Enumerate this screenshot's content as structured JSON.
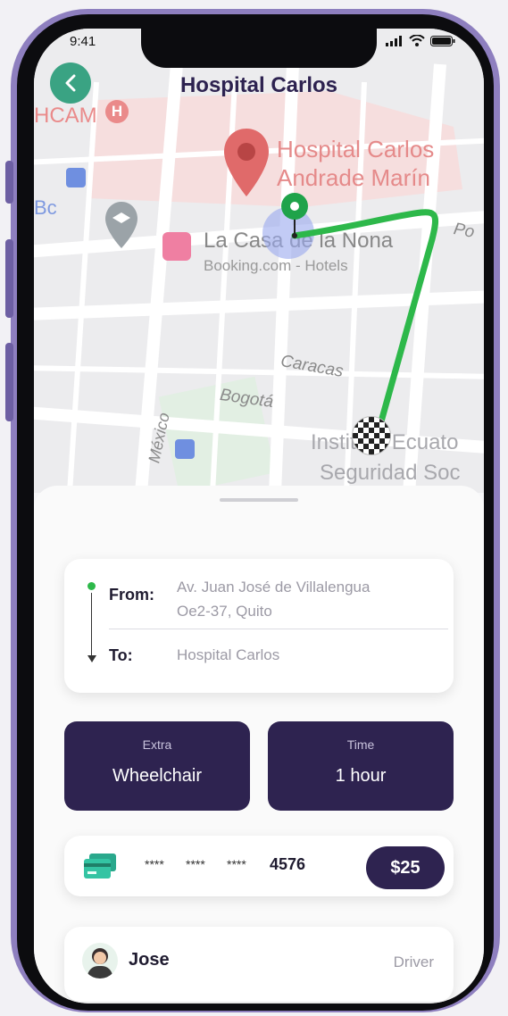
{
  "status_bar": {
    "time": "9:41"
  },
  "header": {
    "title": "Hospital Carlos"
  },
  "map": {
    "labels": {
      "hcam": "HCAM",
      "hospital_line1": "Hospital Carlos",
      "hospital_line2": "Andrade Marín",
      "bc": "Bc",
      "la_casa": "La Casa de la Nona",
      "booking": "Booking.com - Hotels",
      "po": "Po",
      "caracas": "Caracas",
      "bogota": "Bogotá",
      "mexico": "México",
      "instituto": "Instituto Ecuato",
      "seguridad": "Seguridad Soc"
    },
    "colors": {
      "route": "#2db84a",
      "pin": "#e05a5a",
      "user_dot": "#9aa9ee"
    }
  },
  "route": {
    "from_label": "From:",
    "from_value_line1": "Av. Juan José de Villalengua",
    "from_value_line2": "Oe2-37, Quito",
    "to_label": "To:",
    "to_value": "Hospital Carlos"
  },
  "options": {
    "extra": {
      "caption": "Extra",
      "value": "Wheelchair"
    },
    "time": {
      "caption": "Time",
      "value": "1 hour"
    }
  },
  "payment": {
    "icon": "credit-card-icon",
    "mask1": "****",
    "mask2": "****",
    "mask3": "****",
    "last4": "4576",
    "price": "$25"
  },
  "driver": {
    "name": "Jose",
    "role": "Driver",
    "icon": "avatar-icon"
  },
  "theme": {
    "primary": "#2e2350",
    "accent": "#3aa383"
  }
}
